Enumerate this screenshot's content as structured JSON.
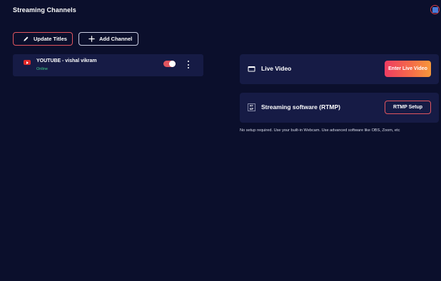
{
  "header": {
    "title": "Streaming Channels"
  },
  "toolbar": {
    "update_titles_label": "Update Titles",
    "add_channel_label": "Add Channel"
  },
  "channels": [
    {
      "platform": "YOUTUBE",
      "user": "- vishal vikram",
      "status": "Online",
      "enabled": true,
      "icon": "youtube-icon"
    }
  ],
  "options": {
    "live_video": {
      "title": "Live Video",
      "button_label": "Enter Live Video",
      "icon": "video-camera-icon"
    },
    "rtmp": {
      "title": "Streaming software (RTMP)",
      "button_label": "RTMP Setup",
      "icon": "rtmp-icon",
      "icon_text": "RT MP"
    },
    "help_text": "No setup required. Use your built-in Webcam. Use advanced software like OBS, Zoom, etc"
  },
  "colors": {
    "background": "#0b0f2c",
    "card": "#161b45",
    "accent": "#e0555f",
    "online": "#3fd18a"
  }
}
